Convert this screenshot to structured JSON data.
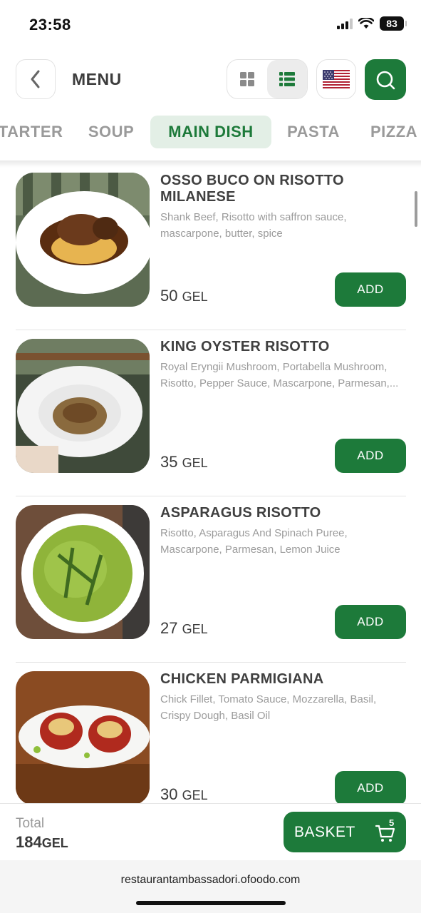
{
  "status": {
    "time": "23:58",
    "battery": "83"
  },
  "header": {
    "title": "MENU"
  },
  "tabs": [
    {
      "label": "STARTER",
      "active": false
    },
    {
      "label": "SOUP",
      "active": false
    },
    {
      "label": "MAIN DISH",
      "active": true
    },
    {
      "label": "PASTA",
      "active": false
    },
    {
      "label": "PIZZA",
      "active": false
    }
  ],
  "items": [
    {
      "name": "OSSO BUCO ON RISOTTO MILANESE",
      "description": "Shank Beef, Risotto with saffron sauce, mascarpone, butter, spice",
      "price": "50",
      "currency": "GEL",
      "add_label": "ADD"
    },
    {
      "name": "KING OYSTER RISOTTO",
      "description": "Royal Eryngii Mushroom, Portabella Mushroom, Risotto, Pepper Sauce, Mascarpone, Parmesan,...",
      "price": "35",
      "currency": "GEL",
      "add_label": "ADD"
    },
    {
      "name": "ASPARAGUS RISOTTO",
      "description": "Risotto, Asparagus And Spinach Puree, Mascarpone, Parmesan, Lemon Juice",
      "price": "27",
      "currency": "GEL",
      "add_label": "ADD"
    },
    {
      "name": "CHICKEN PARMIGIANA",
      "description": "Chick Fillet, Tomato Sauce, Mozzarella, Basil, Crispy Dough, Basil Oil",
      "price": "30",
      "currency": "GEL",
      "add_label": "ADD"
    }
  ],
  "footer": {
    "total_label": "Total",
    "total_value": "184",
    "total_currency": "GEL",
    "basket_label": "BASKET",
    "basket_count": "5"
  },
  "browser": {
    "url": "restaurantambassadori.ofoodo.com"
  },
  "colors": {
    "accent": "#1d7a3a",
    "tab_active_bg": "#e3efe6"
  },
  "icons": [
    "chevron-left-icon",
    "grid-view-icon",
    "list-view-icon",
    "us-flag-icon",
    "search-icon",
    "cart-icon"
  ]
}
